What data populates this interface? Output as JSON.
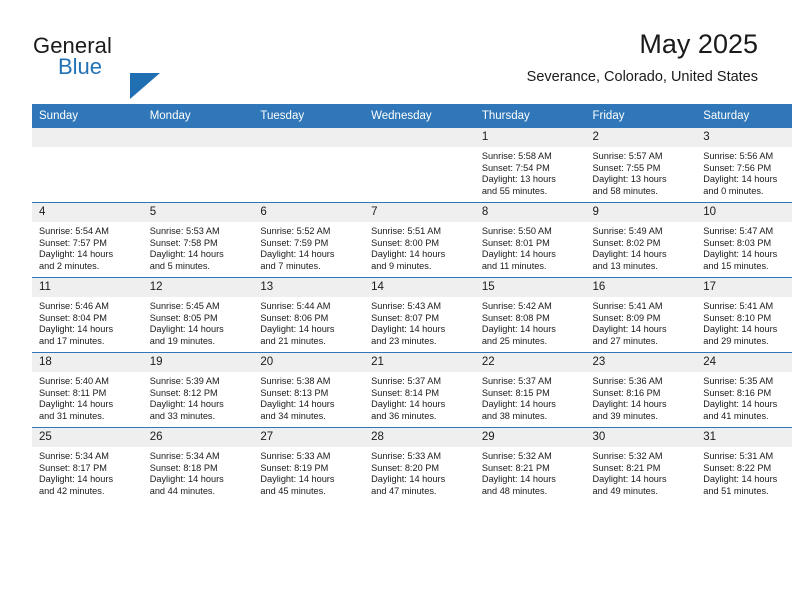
{
  "brand": {
    "word1": "General",
    "word2": "Blue",
    "triangle_color": "#1f6fb2",
    "blue_text_color": "#2372b5"
  },
  "header": {
    "title": "May 2025",
    "subtitle": "Severance, Colorado, United States"
  },
  "theme": {
    "header_bg": "#2f77b8",
    "daynum_bg": "#efefef",
    "row_border": "#2f77b8",
    "text": "#1a1a1a"
  },
  "weekday_headers": [
    "Sunday",
    "Monday",
    "Tuesday",
    "Wednesday",
    "Thursday",
    "Friday",
    "Saturday"
  ],
  "weeks": [
    [
      {
        "day": "",
        "empty": true,
        "sunrise": "",
        "sunset": "",
        "daylight_line1": "",
        "daylight_line2": ""
      },
      {
        "day": "",
        "empty": true,
        "sunrise": "",
        "sunset": "",
        "daylight_line1": "",
        "daylight_line2": ""
      },
      {
        "day": "",
        "empty": true,
        "sunrise": "",
        "sunset": "",
        "daylight_line1": "",
        "daylight_line2": ""
      },
      {
        "day": "",
        "empty": true,
        "sunrise": "",
        "sunset": "",
        "daylight_line1": "",
        "daylight_line2": ""
      },
      {
        "day": "1",
        "empty": false,
        "sunrise": "Sunrise: 5:58 AM",
        "sunset": "Sunset: 7:54 PM",
        "daylight_line1": "Daylight: 13 hours",
        "daylight_line2": "and 55 minutes."
      },
      {
        "day": "2",
        "empty": false,
        "sunrise": "Sunrise: 5:57 AM",
        "sunset": "Sunset: 7:55 PM",
        "daylight_line1": "Daylight: 13 hours",
        "daylight_line2": "and 58 minutes."
      },
      {
        "day": "3",
        "empty": false,
        "sunrise": "Sunrise: 5:56 AM",
        "sunset": "Sunset: 7:56 PM",
        "daylight_line1": "Daylight: 14 hours",
        "daylight_line2": "and 0 minutes."
      }
    ],
    [
      {
        "day": "4",
        "empty": false,
        "sunrise": "Sunrise: 5:54 AM",
        "sunset": "Sunset: 7:57 PM",
        "daylight_line1": "Daylight: 14 hours",
        "daylight_line2": "and 2 minutes."
      },
      {
        "day": "5",
        "empty": false,
        "sunrise": "Sunrise: 5:53 AM",
        "sunset": "Sunset: 7:58 PM",
        "daylight_line1": "Daylight: 14 hours",
        "daylight_line2": "and 5 minutes."
      },
      {
        "day": "6",
        "empty": false,
        "sunrise": "Sunrise: 5:52 AM",
        "sunset": "Sunset: 7:59 PM",
        "daylight_line1": "Daylight: 14 hours",
        "daylight_line2": "and 7 minutes."
      },
      {
        "day": "7",
        "empty": false,
        "sunrise": "Sunrise: 5:51 AM",
        "sunset": "Sunset: 8:00 PM",
        "daylight_line1": "Daylight: 14 hours",
        "daylight_line2": "and 9 minutes."
      },
      {
        "day": "8",
        "empty": false,
        "sunrise": "Sunrise: 5:50 AM",
        "sunset": "Sunset: 8:01 PM",
        "daylight_line1": "Daylight: 14 hours",
        "daylight_line2": "and 11 minutes."
      },
      {
        "day": "9",
        "empty": false,
        "sunrise": "Sunrise: 5:49 AM",
        "sunset": "Sunset: 8:02 PM",
        "daylight_line1": "Daylight: 14 hours",
        "daylight_line2": "and 13 minutes."
      },
      {
        "day": "10",
        "empty": false,
        "sunrise": "Sunrise: 5:47 AM",
        "sunset": "Sunset: 8:03 PM",
        "daylight_line1": "Daylight: 14 hours",
        "daylight_line2": "and 15 minutes."
      }
    ],
    [
      {
        "day": "11",
        "empty": false,
        "sunrise": "Sunrise: 5:46 AM",
        "sunset": "Sunset: 8:04 PM",
        "daylight_line1": "Daylight: 14 hours",
        "daylight_line2": "and 17 minutes."
      },
      {
        "day": "12",
        "empty": false,
        "sunrise": "Sunrise: 5:45 AM",
        "sunset": "Sunset: 8:05 PM",
        "daylight_line1": "Daylight: 14 hours",
        "daylight_line2": "and 19 minutes."
      },
      {
        "day": "13",
        "empty": false,
        "sunrise": "Sunrise: 5:44 AM",
        "sunset": "Sunset: 8:06 PM",
        "daylight_line1": "Daylight: 14 hours",
        "daylight_line2": "and 21 minutes."
      },
      {
        "day": "14",
        "empty": false,
        "sunrise": "Sunrise: 5:43 AM",
        "sunset": "Sunset: 8:07 PM",
        "daylight_line1": "Daylight: 14 hours",
        "daylight_line2": "and 23 minutes."
      },
      {
        "day": "15",
        "empty": false,
        "sunrise": "Sunrise: 5:42 AM",
        "sunset": "Sunset: 8:08 PM",
        "daylight_line1": "Daylight: 14 hours",
        "daylight_line2": "and 25 minutes."
      },
      {
        "day": "16",
        "empty": false,
        "sunrise": "Sunrise: 5:41 AM",
        "sunset": "Sunset: 8:09 PM",
        "daylight_line1": "Daylight: 14 hours",
        "daylight_line2": "and 27 minutes."
      },
      {
        "day": "17",
        "empty": false,
        "sunrise": "Sunrise: 5:41 AM",
        "sunset": "Sunset: 8:10 PM",
        "daylight_line1": "Daylight: 14 hours",
        "daylight_line2": "and 29 minutes."
      }
    ],
    [
      {
        "day": "18",
        "empty": false,
        "sunrise": "Sunrise: 5:40 AM",
        "sunset": "Sunset: 8:11 PM",
        "daylight_line1": "Daylight: 14 hours",
        "daylight_line2": "and 31 minutes."
      },
      {
        "day": "19",
        "empty": false,
        "sunrise": "Sunrise: 5:39 AM",
        "sunset": "Sunset: 8:12 PM",
        "daylight_line1": "Daylight: 14 hours",
        "daylight_line2": "and 33 minutes."
      },
      {
        "day": "20",
        "empty": false,
        "sunrise": "Sunrise: 5:38 AM",
        "sunset": "Sunset: 8:13 PM",
        "daylight_line1": "Daylight: 14 hours",
        "daylight_line2": "and 34 minutes."
      },
      {
        "day": "21",
        "empty": false,
        "sunrise": "Sunrise: 5:37 AM",
        "sunset": "Sunset: 8:14 PM",
        "daylight_line1": "Daylight: 14 hours",
        "daylight_line2": "and 36 minutes."
      },
      {
        "day": "22",
        "empty": false,
        "sunrise": "Sunrise: 5:37 AM",
        "sunset": "Sunset: 8:15 PM",
        "daylight_line1": "Daylight: 14 hours",
        "daylight_line2": "and 38 minutes."
      },
      {
        "day": "23",
        "empty": false,
        "sunrise": "Sunrise: 5:36 AM",
        "sunset": "Sunset: 8:16 PM",
        "daylight_line1": "Daylight: 14 hours",
        "daylight_line2": "and 39 minutes."
      },
      {
        "day": "24",
        "empty": false,
        "sunrise": "Sunrise: 5:35 AM",
        "sunset": "Sunset: 8:16 PM",
        "daylight_line1": "Daylight: 14 hours",
        "daylight_line2": "and 41 minutes."
      }
    ],
    [
      {
        "day": "25",
        "empty": false,
        "sunrise": "Sunrise: 5:34 AM",
        "sunset": "Sunset: 8:17 PM",
        "daylight_line1": "Daylight: 14 hours",
        "daylight_line2": "and 42 minutes."
      },
      {
        "day": "26",
        "empty": false,
        "sunrise": "Sunrise: 5:34 AM",
        "sunset": "Sunset: 8:18 PM",
        "daylight_line1": "Daylight: 14 hours",
        "daylight_line2": "and 44 minutes."
      },
      {
        "day": "27",
        "empty": false,
        "sunrise": "Sunrise: 5:33 AM",
        "sunset": "Sunset: 8:19 PM",
        "daylight_line1": "Daylight: 14 hours",
        "daylight_line2": "and 45 minutes."
      },
      {
        "day": "28",
        "empty": false,
        "sunrise": "Sunrise: 5:33 AM",
        "sunset": "Sunset: 8:20 PM",
        "daylight_line1": "Daylight: 14 hours",
        "daylight_line2": "and 47 minutes."
      },
      {
        "day": "29",
        "empty": false,
        "sunrise": "Sunrise: 5:32 AM",
        "sunset": "Sunset: 8:21 PM",
        "daylight_line1": "Daylight: 14 hours",
        "daylight_line2": "and 48 minutes."
      },
      {
        "day": "30",
        "empty": false,
        "sunrise": "Sunrise: 5:32 AM",
        "sunset": "Sunset: 8:21 PM",
        "daylight_line1": "Daylight: 14 hours",
        "daylight_line2": "and 49 minutes."
      },
      {
        "day": "31",
        "empty": false,
        "sunrise": "Sunrise: 5:31 AM",
        "sunset": "Sunset: 8:22 PM",
        "daylight_line1": "Daylight: 14 hours",
        "daylight_line2": "and 51 minutes."
      }
    ]
  ]
}
